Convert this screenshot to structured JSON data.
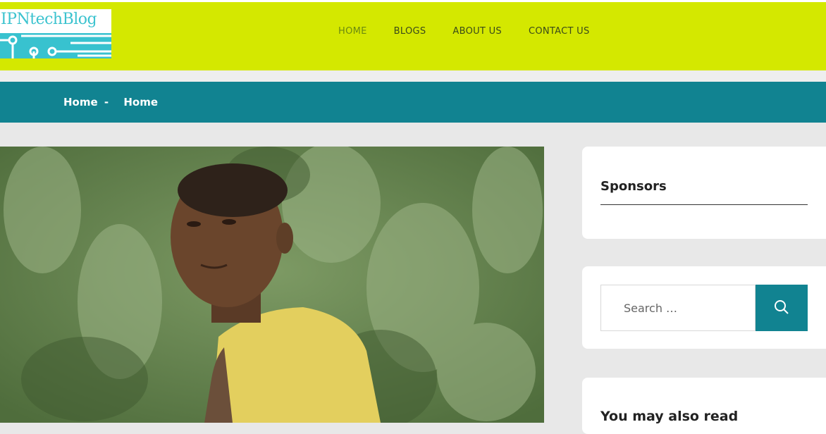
{
  "header": {
    "logo_text": "IPNtechBlog",
    "nav": [
      "HOME",
      "BLOGS",
      "ABOUT US",
      "CONTACT US"
    ],
    "active_nav": "HOME"
  },
  "breadcrumb": {
    "first": "Home",
    "separator": "-",
    "current": "Home"
  },
  "sidebar": {
    "sponsors_title": "Sponsors",
    "search_placeholder": "Search …",
    "read_title": "You may also read"
  },
  "colors": {
    "header_bg": "#d4e800",
    "breadcrumb_bg": "#118391",
    "logo_accent": "#38c2cf",
    "page_bg": "#e8e8e8"
  },
  "icons": {
    "search_button": "search-icon"
  }
}
